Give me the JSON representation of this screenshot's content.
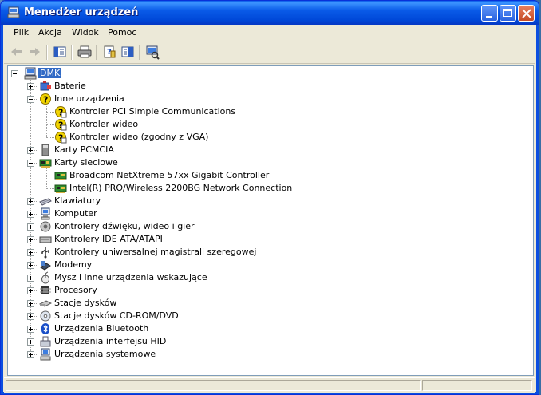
{
  "window": {
    "title": "Menedżer urządzeń",
    "controls": [
      "minimize-icon",
      "maximize-icon",
      "close-icon"
    ]
  },
  "menu": {
    "items": [
      {
        "label": "Plik"
      },
      {
        "label": "Akcja"
      },
      {
        "label": "Widok"
      },
      {
        "label": "Pomoc"
      }
    ]
  },
  "toolbar": {
    "buttons": [
      "back-arrow-icon",
      "forward-arrow-icon",
      "show-hide-console-tree-icon",
      "print-icon",
      "properties-icon",
      "help-icon",
      "scan-hardware-icon"
    ]
  },
  "tree": {
    "root": {
      "label": "DMK",
      "icon": "computer-icon",
      "selected": true
    },
    "nodes": [
      {
        "label": "Baterie",
        "icon": "battery-icon",
        "expanded": false
      },
      {
        "label": "Inne urządzenia",
        "icon": "unknown-device-icon",
        "expanded": true,
        "children": [
          {
            "label": "Kontroler PCI Simple Communications",
            "icon": "warning-device-icon"
          },
          {
            "label": "Kontroler wideo",
            "icon": "warning-device-icon"
          },
          {
            "label": "Kontroler wideo (zgodny z VGA)",
            "icon": "warning-device-icon"
          }
        ]
      },
      {
        "label": "Karty PCMCIA",
        "icon": "pcmcia-icon",
        "expanded": false
      },
      {
        "label": "Karty sieciowe",
        "icon": "network-card-icon",
        "expanded": true,
        "children": [
          {
            "label": "Broadcom NetXtreme 57xx Gigabit Controller",
            "icon": "network-card-icon"
          },
          {
            "label": "Intel(R) PRO/Wireless 2200BG Network Connection",
            "icon": "network-card-icon"
          }
        ]
      },
      {
        "label": "Klawiatury",
        "icon": "keyboard-icon",
        "expanded": false
      },
      {
        "label": "Komputer",
        "icon": "computer-icon",
        "expanded": false
      },
      {
        "label": "Kontrolery dźwięku, wideo i gier",
        "icon": "sound-icon",
        "expanded": false
      },
      {
        "label": "Kontrolery IDE ATA/ATAPI",
        "icon": "ide-icon",
        "expanded": false
      },
      {
        "label": "Kontrolery uniwersalnej magistrali szeregowej",
        "icon": "usb-icon",
        "expanded": false
      },
      {
        "label": "Modemy",
        "icon": "modem-icon",
        "expanded": false
      },
      {
        "label": "Mysz i inne urządzenia wskazujące",
        "icon": "mouse-icon",
        "expanded": false
      },
      {
        "label": "Procesory",
        "icon": "processor-icon",
        "expanded": false
      },
      {
        "label": "Stacje dysków",
        "icon": "disk-drive-icon",
        "expanded": false
      },
      {
        "label": "Stacje dysków CD-ROM/DVD",
        "icon": "cdrom-icon",
        "expanded": false
      },
      {
        "label": "Urządzenia Bluetooth",
        "icon": "bluetooth-icon",
        "expanded": false
      },
      {
        "label": "Urządzenia interfejsu HID",
        "icon": "hid-icon",
        "expanded": false
      },
      {
        "label": "Urządzenia systemowe",
        "icon": "system-device-icon",
        "expanded": false
      }
    ]
  },
  "colors": {
    "titlebar": "#0a5be8",
    "selection": "#316ac5",
    "window_bg": "#ece9d8"
  }
}
